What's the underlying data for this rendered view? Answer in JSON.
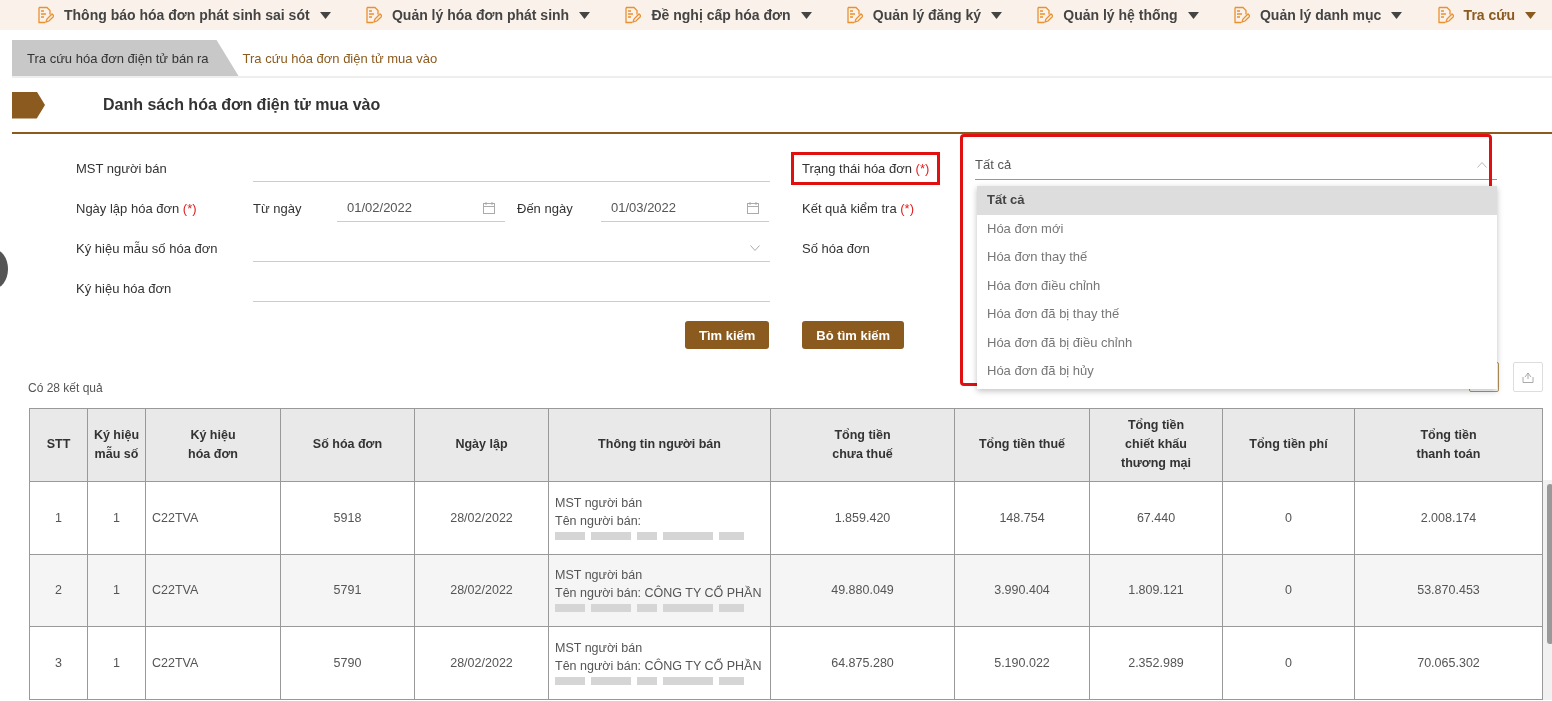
{
  "menu": [
    {
      "label": "Thông báo hóa đơn phát sinh sai sót",
      "active": false
    },
    {
      "label": "Quản lý hóa đơn phát sinh",
      "active": false
    },
    {
      "label": "Đề nghị cấp hóa đơn",
      "active": false
    },
    {
      "label": "Quản lý đăng ký",
      "active": false
    },
    {
      "label": "Quản lý hệ thống",
      "active": false
    },
    {
      "label": "Quản lý danh mục",
      "active": false
    },
    {
      "label": "Tra cứu",
      "active": true
    }
  ],
  "tabs": [
    {
      "label": "Tra cứu hóa đơn điện tử bán ra",
      "selected": false
    },
    {
      "label": "Tra cứu hóa đơn điện tử mua vào",
      "selected": true
    }
  ],
  "page_title": "Danh sách hóa đơn điện tử mua vào",
  "form": {
    "seller_tax_code": {
      "label": "MST người bán"
    },
    "issue_date": {
      "label": "Ngày lập hóa đơn",
      "required_mark": "(*)",
      "from_label": "Từ ngày",
      "from_value": "01/02/2022",
      "to_label": "Đến ngày",
      "to_value": "01/03/2022"
    },
    "template_code": {
      "label": "Ký hiệu mẫu số hóa đơn"
    },
    "invoice_series": {
      "label": "Ký hiệu hóa đơn"
    },
    "status": {
      "label": "Trạng thái hóa đơn",
      "required_mark": "(*)",
      "highlighted": true,
      "value": "Tất cả",
      "expanded": true,
      "options": [
        {
          "label": "Tất cả",
          "selected": true
        },
        {
          "label": "Hóa đơn mới",
          "selected": false
        },
        {
          "label": "Hóa đơn thay thế",
          "selected": false
        },
        {
          "label": "Hóa đơn điều chỉnh",
          "selected": false
        },
        {
          "label": "Hóa đơn đã bị thay thế",
          "selected": false
        },
        {
          "label": "Hóa đơn đã bị điều chỉnh",
          "selected": false
        },
        {
          "label": "Hóa đơn đã bị hủy",
          "selected": false
        }
      ]
    },
    "check_result": {
      "label": "Kết quả kiểm tra",
      "required_mark": "(*)"
    },
    "invoice_number": {
      "label": "Số hóa đơn"
    }
  },
  "buttons": [
    {
      "label": "Tìm kiếm"
    },
    {
      "label": "Bỏ tìm kiếm"
    }
  ],
  "result_count": "Có 28 kết quả",
  "table": {
    "columns": [
      "STT",
      "Ký hiệu\nmẫu số",
      "Ký hiệu\nhóa đơn",
      "Số hóa đơn",
      "Ngày lập",
      "Thông tin người bán",
      "Tổng tiền\nchưa thuế",
      "Tổng tiền thuế",
      "Tổng tiền\nchiết khấu\nthương mại",
      "Tổng tiền phí",
      "Tổng tiền\nthanh toán"
    ],
    "rows": [
      {
        "stt": "1",
        "template": "1",
        "series": "C22TVA",
        "number": "5918",
        "date": "28/02/2022",
        "seller": {
          "tax_code_label": "MST người bán",
          "name_label": "Tên người bán:"
        },
        "totals": [
          "1.859.420",
          "148.754",
          "67.440",
          "0",
          "2.008.174"
        ]
      },
      {
        "stt": "2",
        "template": "1",
        "series": "C22TVA",
        "number": "5791",
        "date": "28/02/2022",
        "seller": {
          "tax_code_label": "MST người bán",
          "name_label": "Tên người bán: CÔNG TY CỔ PHẦN"
        },
        "totals": [
          "49.880.049",
          "3.990.404",
          "1.809.121",
          "0",
          "53.870.453"
        ]
      },
      {
        "stt": "3",
        "template": "1",
        "series": "C22TVA",
        "number": "5790",
        "date": "28/02/2022",
        "seller": {
          "tax_code_label": "MST người bán",
          "name_label": "Tên người bán: CÔNG TY CỔ PHẦN"
        },
        "totals": [
          "64.875.280",
          "5.190.022",
          "2.352.989",
          "0",
          "70.065.302"
        ]
      }
    ]
  }
}
